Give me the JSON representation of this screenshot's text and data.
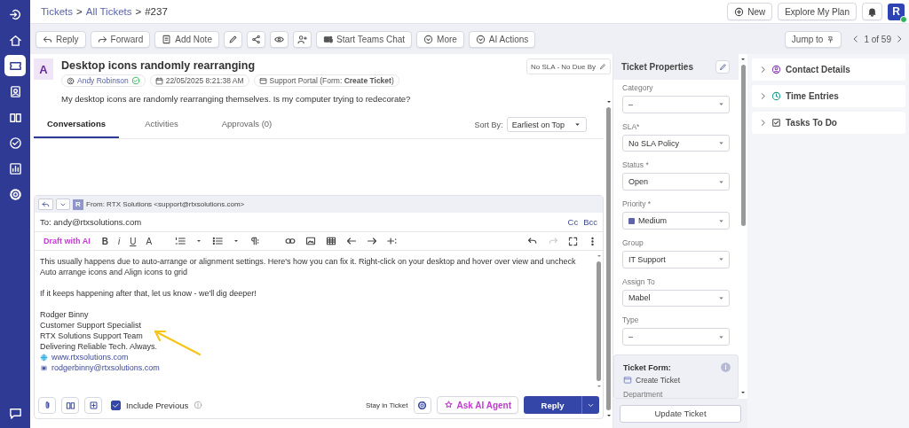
{
  "sidebar": {
    "items": [
      {
        "selected": false
      },
      {
        "selected": false
      },
      {
        "selected": true
      },
      {
        "selected": false
      },
      {
        "selected": false
      },
      {
        "selected": false
      },
      {
        "selected": false
      },
      {
        "selected": false
      }
    ],
    "chat": {
      "selected": false
    }
  },
  "breadcrumb": [
    {
      "label": "Tickets",
      "kind": "link"
    },
    {
      "label": ">",
      "kind": "separator"
    },
    {
      "label": "All Tickets",
      "kind": "link"
    },
    {
      "label": ">",
      "kind": "separator"
    },
    {
      "label": "#237",
      "kind": "current"
    }
  ],
  "header_actions": {
    "new": "New",
    "plan": "Explore My Plan",
    "avatar": "R",
    "online": true
  },
  "toolbar": [
    {
      "label": "Reply",
      "kind": "plain"
    },
    {
      "label": "Forward",
      "kind": "plain"
    },
    {
      "label": "Add Note",
      "kind": "plain"
    },
    {
      "kind": "icon"
    },
    {
      "kind": "icon"
    },
    {
      "kind": "icon"
    },
    {
      "kind": "icon"
    },
    {
      "label": "Start Teams Chat",
      "kind": "plain"
    },
    {
      "label": "More",
      "kind": "plain"
    },
    {
      "label": "AI Actions",
      "kind": "ai"
    }
  ],
  "jump_to": "Jump to",
  "pager": "1 of 59",
  "ticket": {
    "avatar": "A",
    "title": "Desktop icons randomly rearranging",
    "requester": "Andy Robinson",
    "verified": true,
    "date": "22/05/2025 8:21:38 AM",
    "source": "Support Portal (Form: **Create Ticket**)",
    "description": "My desktop icons are randomly rearranging themselves. Is my computer trying to redecorate?",
    "sla": "No SLA - No Due By"
  },
  "tabs": [
    {
      "label": "Conversations",
      "selected": true
    },
    {
      "label": "Activities",
      "selected": false
    },
    {
      "label": "Approvals (0)",
      "selected": false
    }
  ],
  "sort": {
    "label": "Sort By:",
    "value": "Earliest on Top"
  },
  "composer": {
    "from_avatar": "R",
    "from": "From: RTX Solutions <support@rtxsolutions.com>",
    "to": "To: andy@rtxsolutions.com",
    "cc": "Cc",
    "bcc": "Bcc",
    "draft_ai": "Draft with AI",
    "format_glyphs": [
      "B",
      "i",
      "U",
      "A"
    ],
    "body": [
      {
        "kind": "text",
        "text": "This usually happens due to auto-arrange or alignment settings. Here's how you can fix it. Right-click on your desktop and hover over view and uncheck Auto arrange icons and Align icons to grid"
      },
      {
        "kind": "gap"
      },
      {
        "kind": "text",
        "text": "If it keeps happening after that, let us know - we'll dig deeper!"
      },
      {
        "kind": "gap"
      },
      {
        "kind": "text",
        "text": "Rodger Binny"
      },
      {
        "kind": "text",
        "text": "Customer Support Specialist"
      },
      {
        "kind": "text",
        "text": "RTX Solutions Support Team"
      },
      {
        "kind": "text",
        "text": "Delivering Reliable Tech. Always."
      },
      {
        "kind": "web",
        "text": "www.rtxsolutions.com"
      },
      {
        "kind": "email",
        "text": "rodgerbinny@rtxsolutions.com"
      }
    ],
    "include_previous": {
      "label": "Include Previous",
      "checked": true
    },
    "stay": "Stay in Ticket",
    "ask_ai": "Ask AI Agent",
    "reply": "Reply"
  },
  "properties": {
    "title": "Ticket Properties",
    "fields": [
      {
        "label": "Category",
        "value": "–"
      },
      {
        "label": "SLA*",
        "value": "No SLA Policy"
      },
      {
        "label": "Status *",
        "value": "Open"
      },
      {
        "label": "Priority *",
        "value": "Medium",
        "color": "#5f63a8"
      },
      {
        "label": "Group",
        "value": "IT Support"
      },
      {
        "label": "Assign To",
        "value": "Mabel"
      },
      {
        "label": "Type",
        "value": "–"
      }
    ],
    "form": {
      "label": "Ticket Form:",
      "value": "Create Ticket",
      "next": "Department"
    },
    "update": "Update Ticket"
  },
  "sections": [
    {
      "label": "Contact Details",
      "expanded": false
    },
    {
      "label": "Time Entries",
      "expanded": false
    },
    {
      "label": "Tasks To Do",
      "expanded": false
    }
  ]
}
